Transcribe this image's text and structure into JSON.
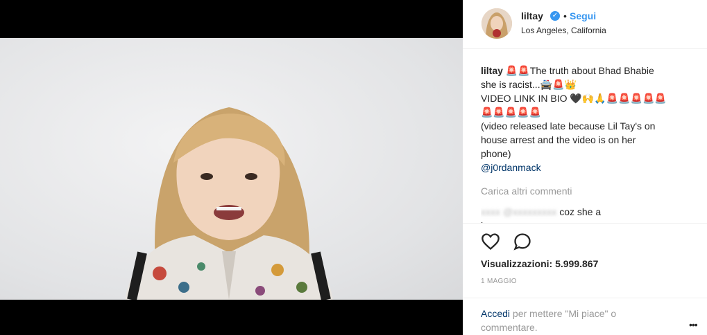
{
  "post": {
    "username": "liltay",
    "follow_label": "Segui",
    "location": "Los Angeles, California",
    "caption_user": "liltay",
    "caption_lines": [
      "🚨🚨The truth about Bhad Bhabie",
      "she is racist...🚔🚨👑",
      "VIDEO LINK IN BIO 🖤🙌🙏🚨🚨🚨🚨🚨",
      "🚨🚨🚨🚨🚨",
      "(video released late because Lil Tay's on",
      "house arrest and the video is on her",
      "phone)"
    ],
    "mention": "@j0rdanmack",
    "load_more": "Carica altri commenti",
    "comment2_user": "xxxx",
    "comment2_mention": "@xxxxxxxxx",
    "comment2_text": "coz she a",
    "comment2_cont": "hoe",
    "views": "Visualizzazioni: 5.999.867",
    "date": "1 MAGGIO",
    "login_link": "Accedi",
    "login_text": " per mettere \"Mi piace\" o commentare.",
    "more_icon": "•••"
  },
  "colors": {
    "accent": "#3897f0",
    "link": "#003569",
    "muted": "#999999"
  }
}
